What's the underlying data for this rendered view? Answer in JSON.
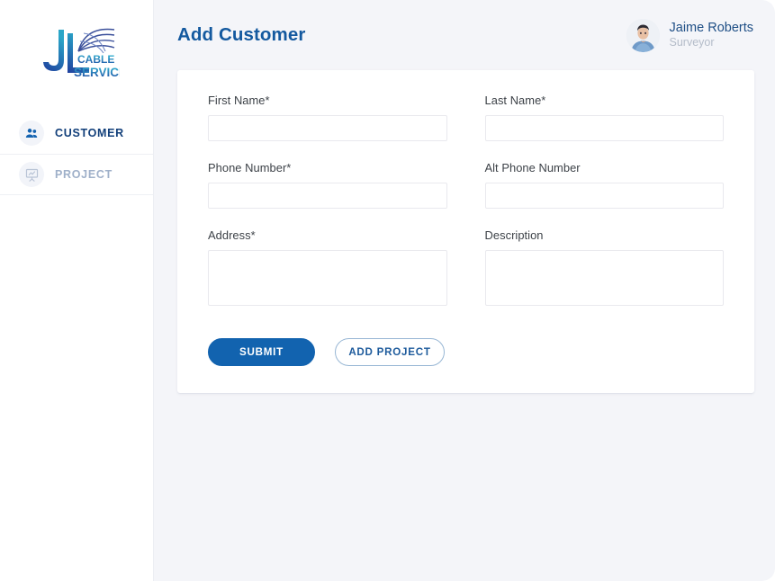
{
  "app": {
    "logo": {
      "mark_letters": "JL",
      "line1": "CABLE",
      "line2": "SERVICES",
      "icon_name": "satellite-dish-icon"
    }
  },
  "sidebar": {
    "items": [
      {
        "label": "CUSTOMER",
        "icon": "users-group-icon",
        "active": true
      },
      {
        "label": "PROJECT",
        "icon": "presentation-board-icon",
        "active": false
      }
    ]
  },
  "header": {
    "title": "Add Customer",
    "user": {
      "name": "Jaime Roberts",
      "role": "Surveyor",
      "avatar_icon": "user-photo-avatar"
    }
  },
  "form": {
    "fields": {
      "first_name": {
        "label": "First Name*",
        "value": "",
        "placeholder": ""
      },
      "last_name": {
        "label": "Last Name*",
        "value": "",
        "placeholder": ""
      },
      "phone_number": {
        "label": "Phone Number*",
        "value": "",
        "placeholder": ""
      },
      "alt_phone_number": {
        "label": "Alt Phone Number",
        "value": "",
        "placeholder": ""
      },
      "address": {
        "label": "Address*",
        "value": "",
        "placeholder": ""
      },
      "description": {
        "label": "Description",
        "value": "",
        "placeholder": ""
      }
    },
    "buttons": {
      "submit": "SUBMIT",
      "add_project": "ADD PROJECT"
    }
  },
  "colors": {
    "brand_blue": "#1263af",
    "title_blue": "#14599f",
    "nav_active": "#123f7a",
    "nav_inactive": "#9fb0c9",
    "page_bg": "#f4f5f9",
    "card_bg": "#ffffff",
    "input_border": "#e9e9ee"
  }
}
